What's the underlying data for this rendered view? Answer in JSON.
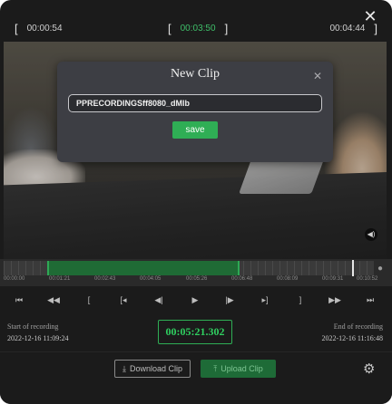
{
  "header": {
    "start_time": "00:00:54",
    "current_time": "00:03:50",
    "end_time": "00:04:44",
    "bracket_open": "[",
    "bracket_close": "]"
  },
  "dialog": {
    "title": "New Clip",
    "close_icon": "close-icon",
    "filename_value": "PPRECORDINGSff8080_dMlb",
    "save_label": "save"
  },
  "timeline": {
    "tick_labels": [
      "00:00:00",
      "00:01:21",
      "00:02:43",
      "00:04:05",
      "00:05:26",
      "00:06:48",
      "00:08:09",
      "00:09:31",
      "00:10:52"
    ]
  },
  "controls": [
    {
      "icon": "skip-to-start-icon",
      "glyph": "⏮"
    },
    {
      "icon": "rewind-icon",
      "glyph": "◀◀"
    },
    {
      "icon": "mark-in-icon",
      "glyph": "["
    },
    {
      "icon": "go-to-mark-in-icon",
      "glyph": "[◂"
    },
    {
      "icon": "step-back-icon",
      "glyph": "◀|"
    },
    {
      "icon": "play-icon",
      "glyph": "▶"
    },
    {
      "icon": "step-forward-icon",
      "glyph": "|▶"
    },
    {
      "icon": "go-to-mark-out-icon",
      "glyph": "▸]"
    },
    {
      "icon": "mark-out-icon",
      "glyph": "]"
    },
    {
      "icon": "fast-forward-icon",
      "glyph": "▶▶"
    },
    {
      "icon": "skip-to-end-icon",
      "glyph": "⏭"
    }
  ],
  "status": {
    "start_label": "Start of recording",
    "start_value": "2022-12-16 11:09:24",
    "clock": "00:05:21.302",
    "end_label": "End of recording",
    "end_value": "2022-12-16 11:16:48"
  },
  "actions": {
    "download_label": "Download Clip",
    "upload_label": "Upload Clip"
  },
  "colors": {
    "accent_green": "#2fae55",
    "background": "#1b1b1b"
  }
}
